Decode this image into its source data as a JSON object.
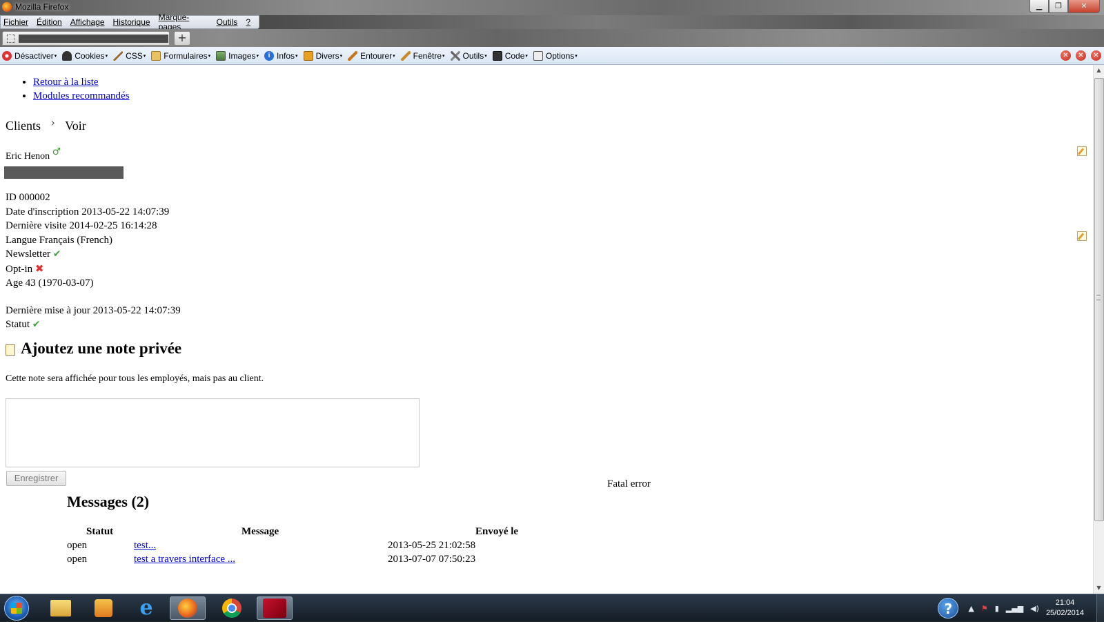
{
  "window": {
    "title": "Mozilla Firefox"
  },
  "menubar": {
    "items": [
      "Fichier",
      "Édition",
      "Affichage",
      "Historique",
      "Marque-pages",
      "Outils",
      "?"
    ]
  },
  "webdev_toolbar": {
    "items": [
      {
        "label": "Désactiver",
        "icon": "disable-icon"
      },
      {
        "label": "Cookies",
        "icon": "cookie-icon"
      },
      {
        "label": "CSS",
        "icon": "css-icon"
      },
      {
        "label": "Formulaires",
        "icon": "forms-icon"
      },
      {
        "label": "Images",
        "icon": "images-icon"
      },
      {
        "label": "Infos",
        "icon": "info-icon"
      },
      {
        "label": "Divers",
        "icon": "misc-icon"
      },
      {
        "label": "Entourer",
        "icon": "outline-icon"
      },
      {
        "label": "Fenêtre",
        "icon": "resize-icon"
      },
      {
        "label": "Outils",
        "icon": "tools-icon"
      },
      {
        "label": "Code",
        "icon": "code-icon"
      },
      {
        "label": "Options",
        "icon": "options-icon"
      }
    ]
  },
  "nav": {
    "back_link": "Retour à la liste",
    "modules_link": "Modules recommandés"
  },
  "breadcrumb": {
    "parent": "Clients",
    "separator": "›",
    "current": "Voir"
  },
  "customer": {
    "name": "Eric Henon",
    "gender_icon": "male-icon",
    "id_label": "ID",
    "id_value": "000002",
    "registration_label": "Date d'inscription",
    "registration_value": "2013-05-22 14:07:39",
    "last_visit_label": "Dernière visite",
    "last_visit_value": "2014-02-25 16:14:28",
    "language_label": "Langue",
    "language_value": "Français (French)",
    "newsletter_label": "Newsletter",
    "newsletter_status": "✔",
    "optin_label": "Opt-in",
    "optin_status": "✖",
    "age_label": "Age",
    "age_value": "43 (1970-03-07)",
    "last_update_label": "Dernière mise à jour",
    "last_update_value": "2013-05-22 14:07:39",
    "status_label": "Statut",
    "status_value": "✔"
  },
  "private_note": {
    "heading": "Ajoutez une note privée",
    "description": "Cette note sera affichée pour tous les employés, mais pas au client.",
    "textarea_value": "",
    "save_button": "Enregistrer"
  },
  "error_text": "Fatal error",
  "messages": {
    "heading": "Messages (2)",
    "columns": [
      "Statut",
      "Message",
      "Envoyé le"
    ],
    "rows": [
      {
        "status": "open",
        "message": "test...",
        "sent": "2013-05-25 21:02:58"
      },
      {
        "status": "open",
        "message": "test a travers interface ...",
        "sent": "2013-07-07 07:50:23"
      }
    ]
  },
  "taskbar": {
    "apps": [
      "start-icon",
      "explorer-icon",
      "media-player-icon",
      "internet-explorer-icon",
      "firefox-icon",
      "chrome-icon",
      "app-icon"
    ],
    "clock_time": "21:04",
    "clock_date": "25/02/2014"
  }
}
